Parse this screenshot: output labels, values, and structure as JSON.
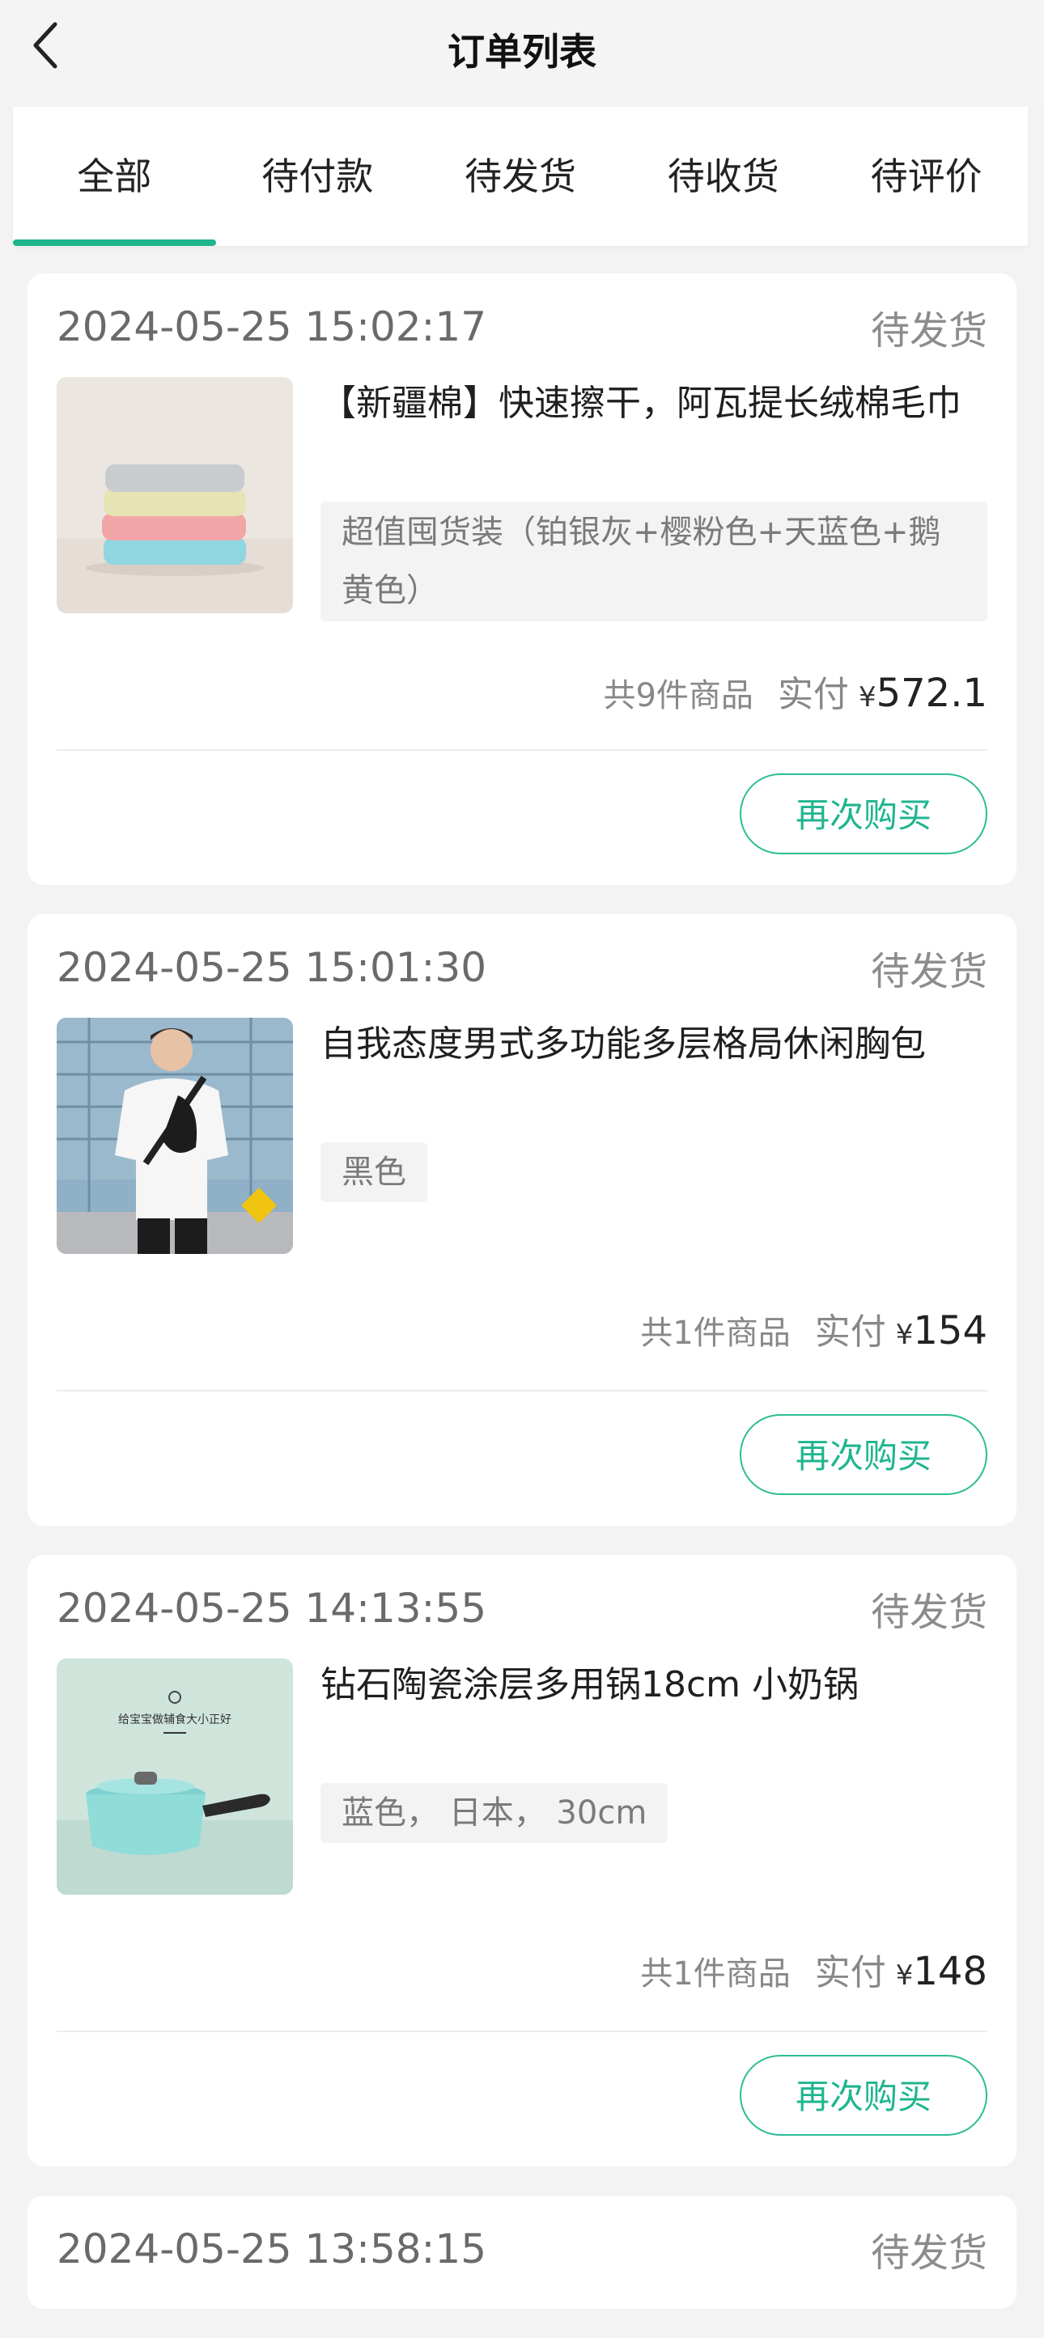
{
  "header": {
    "title": "订单列表",
    "back_icon": "chevron-left-icon"
  },
  "tabs": [
    {
      "label": "全部",
      "active": true
    },
    {
      "label": "待付款",
      "active": false
    },
    {
      "label": "待发货",
      "active": false
    },
    {
      "label": "待收货",
      "active": false
    },
    {
      "label": "待评价",
      "active": false
    }
  ],
  "colors": {
    "accent": "#1fb58f",
    "background": "#f3f3f3",
    "card": "#ffffff"
  },
  "orders": [
    {
      "date": "2024-05-25 15:02:17",
      "status": "待发货",
      "product_name": "【新疆棉】快速擦干，阿瓦提长绒棉毛巾",
      "spec": "超值囤货装（铂银灰+樱粉色+天蓝色+鹅黄色）",
      "count_text": "共9件商品",
      "pay_label": "实付",
      "currency": "¥",
      "amount": "572.1",
      "button": "再次购买",
      "image": "towels-stack-image"
    },
    {
      "date": "2024-05-25 15:01:30",
      "status": "待发货",
      "product_name": "自我态度男式多功能多层格局休闲胸包",
      "spec": "黑色",
      "count_text": "共1件商品",
      "pay_label": "实付",
      "currency": "¥",
      "amount": "154",
      "button": "再次购买",
      "image": "man-with-chest-bag-image"
    },
    {
      "date": "2024-05-25 14:13:55",
      "status": "待发货",
      "product_name": "钻石陶瓷涂层多用锅18cm 小奶锅",
      "spec": "蓝色， 日本， 30cm",
      "count_text": "共1件商品",
      "pay_label": "实付",
      "currency": "¥",
      "amount": "148",
      "button": "再次购买",
      "image": "milk-pot-image",
      "image_caption": "给宝宝做辅食大小正好"
    },
    {
      "date": "2024-05-25 13:58:15",
      "status": "待发货"
    }
  ]
}
